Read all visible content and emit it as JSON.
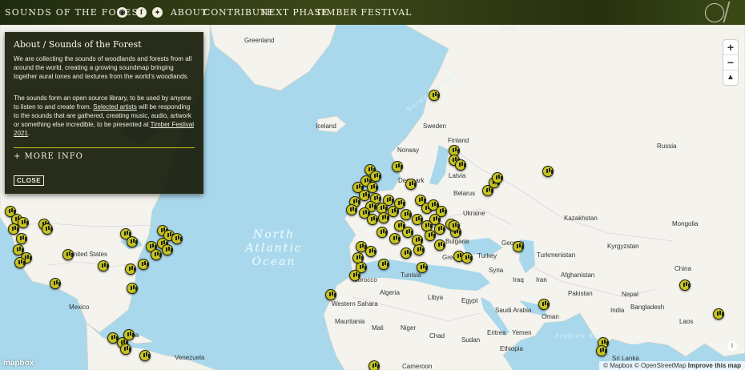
{
  "header": {
    "brand": "SOUNDS OF THE FOREST",
    "nav": [
      "ABOUT",
      "CONTRIBUTE",
      "NEXT PHASE",
      "TIMBER FESTIVAL"
    ],
    "social": [
      "facebook-icon",
      "twitter-icon"
    ]
  },
  "panel": {
    "title": "About / Sounds of the Forest",
    "para1": "We are collecting the sounds of woodlands and forests from all around the world, creating a growing soundmap bringing together aural tones and textures from the world’s woodlands.",
    "para2_a": "The sounds form an open source library, to be used by anyone to listen to and create from.",
    "para2_link1": "Selected artists",
    "para2_b": "will be responding to the sounds that are gathered, creating music, audio, artwork or something else incredible, to be presented at",
    "para2_link2": "Timber Festival 2021",
    "para2_c": ".",
    "more": "+ MORE INFO",
    "close": "CLOSE"
  },
  "map": {
    "ocean_label_lines": [
      "North",
      "Atlantic",
      "Ocean"
    ],
    "sea_labels": [
      "Norwegian Sea",
      "Sea",
      "Arabian Sea"
    ],
    "country_labels": [
      "Greenland",
      "Iceland",
      "Sweden",
      "Finland",
      "Norway",
      "Denmark",
      "Latvia",
      "Belarus",
      "Ukraine",
      "Russia",
      "Kazakhstan",
      "Mongolia",
      "Kyrgyzstan",
      "Turkmenistan",
      "Georgia",
      "Bulgaria",
      "Turkey",
      "Greece",
      "Syria",
      "Iraq",
      "Iran",
      "Afghanistan",
      "Pakistan",
      "Nepal",
      "India",
      "Bangladesh",
      "Laos",
      "China",
      "Tunisia",
      "Morocco",
      "Algeria",
      "Libya",
      "Egypt",
      "Saudi Arabia",
      "Oman",
      "Yemen",
      "Western Sahara",
      "Mauritania",
      "Mali",
      "Niger",
      "Chad",
      "Sudan",
      "Eritrea",
      "Ethiopia",
      "Cameroon",
      "Sri Lanka",
      "United States",
      "Mexico",
      "Cuba",
      "Venezuela"
    ],
    "controls": {
      "zoom_in": "+",
      "zoom_out": "−"
    },
    "attribution": {
      "mapbox": "© Mapbox",
      "osm": "© OpenStreetMap",
      "improve": "Improve this map"
    },
    "logo": "mapbox"
  },
  "colors": {
    "marker": "#c8c221",
    "header": "#2f3a14",
    "panel": "#1b2110",
    "water": "#a9d8ec",
    "land": "#f4f3ed"
  }
}
